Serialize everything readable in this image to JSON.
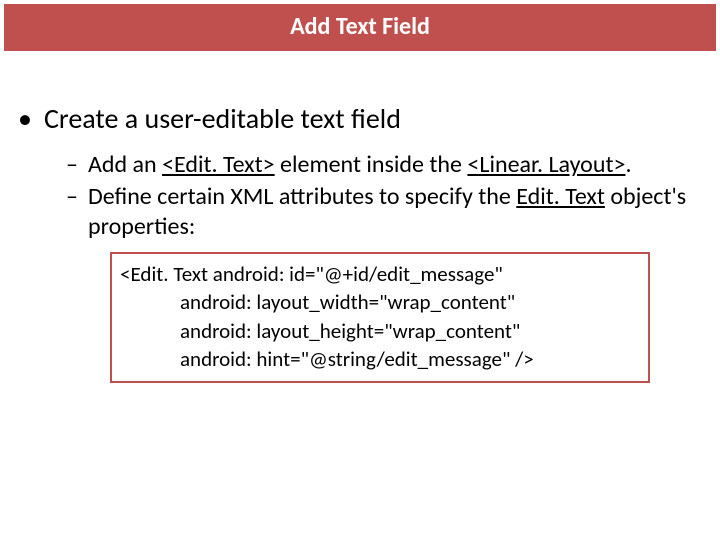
{
  "title": "Add Text Field",
  "bullet1": "Create a user-editable text field",
  "sub1_pre": "Add an ",
  "sub1_u1": "<Edit. Text>",
  "sub1_mid": " element inside the ",
  "sub1_u2": "<Linear. Layout>",
  "sub1_post": ".",
  "sub2_pre": "Define certain XML attributes to specify the ",
  "sub2_u": "Edit. Text",
  "sub2_post": " object's properties:",
  "code_l1": "<Edit. Text android: id=\"@+id/edit_message\"",
  "code_l2": "android: layout_width=\"wrap_content\"",
  "code_l3": "android: layout_height=\"wrap_content\"",
  "code_l4": "android: hint=\"@string/edit_message\" />"
}
